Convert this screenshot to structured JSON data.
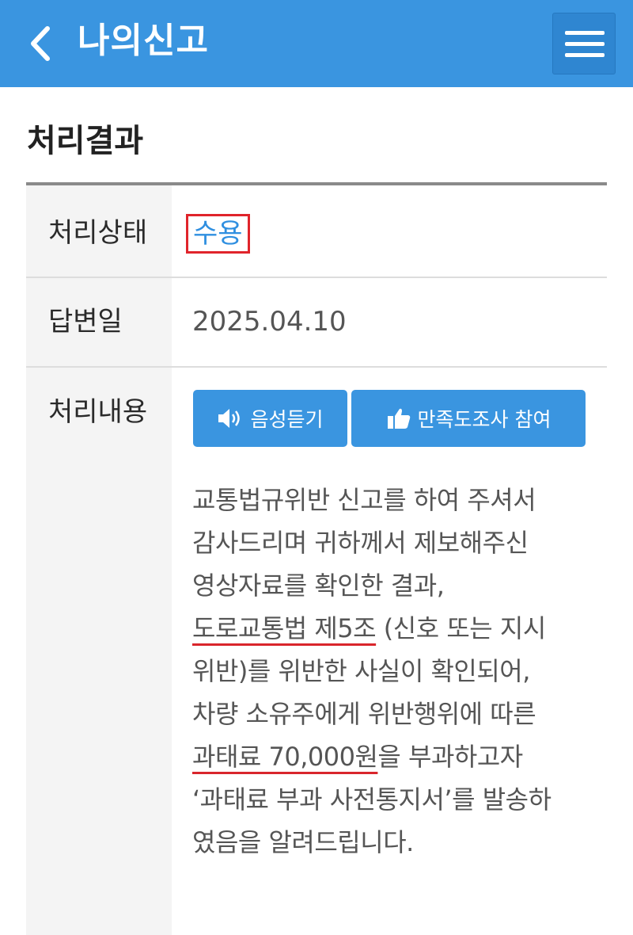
{
  "header": {
    "title": "나의신고",
    "back_icon": "chevron-left-icon",
    "menu_icon": "hamburger-menu-icon",
    "color": "#3a95e0"
  },
  "section": {
    "title": "처리결과"
  },
  "rows": {
    "status": {
      "label": "처리상태",
      "value": "수용",
      "value_color": "#2f8fe0",
      "highlight_color": "#e0242b"
    },
    "reply_date": {
      "label": "답변일",
      "value": "2025.04.10"
    },
    "details": {
      "label": "처리내용",
      "buttons": {
        "listen": {
          "label": "음성듣기",
          "icon": "speaker-icon"
        },
        "survey": {
          "label": "만족도조사 참여",
          "icon": "thumbs-up-icon"
        }
      },
      "lines": [
        "교통법규위반 신고를 하여 주셔서",
        "감사드리며 귀하께서 제보해주신",
        "영상자료를 확인한 결과,",
        {
          "underlined": "도로교통법 제5조",
          "rest": " (신호 또는 지시"
        },
        "위반)를 위반한 사실이 확인되어,",
        "차량 소유주에게 위반행위에 따른",
        {
          "underlined": "과태료 70,000원",
          "rest": "을 부과하고자"
        },
        "‘과태료 부과 사전통지서’를 발송하",
        "였음을 알려드립니다."
      ]
    }
  }
}
